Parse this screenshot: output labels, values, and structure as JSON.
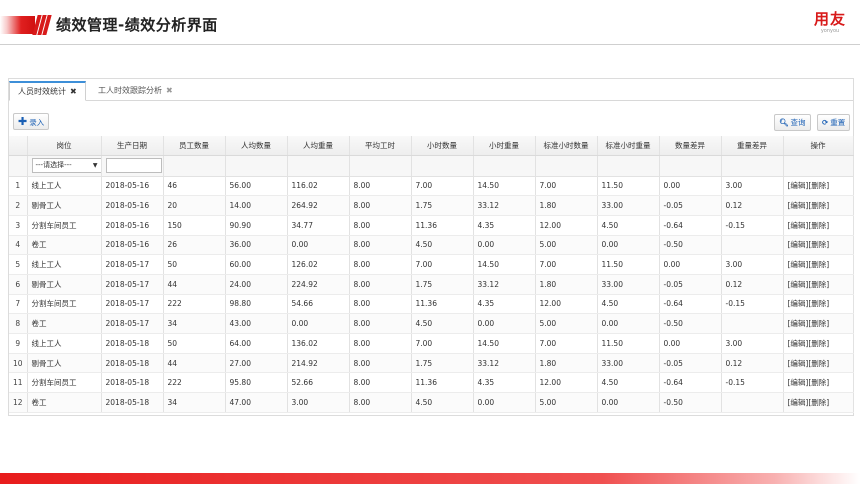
{
  "header": {
    "title": "绩效管理-绩效分析界面",
    "logo_text": "用友",
    "logo_sub": "yonyou"
  },
  "tabs": [
    {
      "label": "人员时效统计",
      "close": "✖"
    },
    {
      "label": "工人时效跟踪分析",
      "close": "✖"
    }
  ],
  "toolbar": {
    "add_icon": "plus-icon",
    "add_label": "录入",
    "query_label": "查询",
    "reset_label": "重置"
  },
  "filter": {
    "select_value": "---请选择---"
  },
  "table": {
    "columns": [
      "岗位",
      "生产日期",
      "员工数量",
      "人均数量",
      "人均重量",
      "平均工时",
      "小时数量",
      "小时重量",
      "标准小时数量",
      "标准小时重量",
      "数量差异",
      "重量差异",
      "操作"
    ],
    "rows": [
      [
        "1",
        "线上工人",
        "2018-05-16",
        "46",
        "56.00",
        "116.02",
        "8.00",
        "7.00",
        "14.50",
        "7.00",
        "11.50",
        "0.00",
        "3.00",
        "[编辑][删除]"
      ],
      [
        "2",
        "剔骨工人",
        "2018-05-16",
        "20",
        "14.00",
        "264.92",
        "8.00",
        "1.75",
        "33.12",
        "1.80",
        "33.00",
        "-0.05",
        "0.12",
        "[编辑][删除]"
      ],
      [
        "3",
        "分割车间员工",
        "2018-05-16",
        "150",
        "90.90",
        "34.77",
        "8.00",
        "11.36",
        "4.35",
        "12.00",
        "4.50",
        "-0.64",
        "-0.15",
        "[编辑][删除]"
      ],
      [
        "4",
        "卷工",
        "2018-05-16",
        "26",
        "36.00",
        "0.00",
        "8.00",
        "4.50",
        "0.00",
        "5.00",
        "0.00",
        "-0.50",
        "",
        "[编辑][删除]"
      ],
      [
        "5",
        "线上工人",
        "2018-05-17",
        "50",
        "60.00",
        "126.02",
        "8.00",
        "7.00",
        "14.50",
        "7.00",
        "11.50",
        "0.00",
        "3.00",
        "[编辑][删除]"
      ],
      [
        "6",
        "剔骨工人",
        "2018-05-17",
        "44",
        "24.00",
        "224.92",
        "8.00",
        "1.75",
        "33.12",
        "1.80",
        "33.00",
        "-0.05",
        "0.12",
        "[编辑][删除]"
      ],
      [
        "7",
        "分割车间员工",
        "2018-05-17",
        "222",
        "98.80",
        "54.66",
        "8.00",
        "11.36",
        "4.35",
        "12.00",
        "4.50",
        "-0.64",
        "-0.15",
        "[编辑][删除]"
      ],
      [
        "8",
        "卷工",
        "2018-05-17",
        "34",
        "43.00",
        "0.00",
        "8.00",
        "4.50",
        "0.00",
        "5.00",
        "0.00",
        "-0.50",
        "",
        "[编辑][删除]"
      ],
      [
        "9",
        "线上工人",
        "2018-05-18",
        "50",
        "64.00",
        "136.02",
        "8.00",
        "7.00",
        "14.50",
        "7.00",
        "11.50",
        "0.00",
        "3.00",
        "[编辑][删除]"
      ],
      [
        "10",
        "剔骨工人",
        "2018-05-18",
        "44",
        "27.00",
        "214.92",
        "8.00",
        "1.75",
        "33.12",
        "1.80",
        "33.00",
        "-0.05",
        "0.12",
        "[编辑][删除]"
      ],
      [
        "11",
        "分割车间员工",
        "2018-05-18",
        "222",
        "95.80",
        "52.66",
        "8.00",
        "11.36",
        "4.35",
        "12.00",
        "4.50",
        "-0.64",
        "-0.15",
        "[编辑][删除]"
      ],
      [
        "12",
        "卷工",
        "2018-05-18",
        "34",
        "47.00",
        "3.00",
        "8.00",
        "4.50",
        "0.00",
        "5.00",
        "0.00",
        "-0.50",
        "",
        "[编辑][删除]"
      ]
    ]
  },
  "colors": {
    "brand_red": "#d81a1a",
    "link_blue": "#1a5fb4",
    "tab_active": "#3d8fd8"
  }
}
